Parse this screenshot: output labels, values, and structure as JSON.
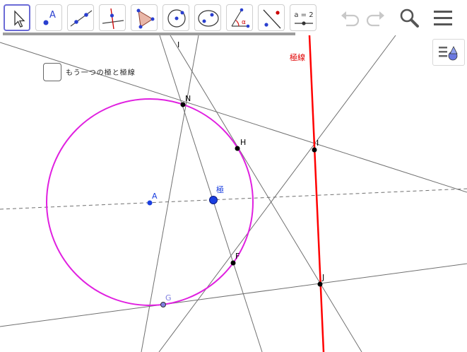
{
  "toolbar": {
    "tools": [
      {
        "name": "move-tool-icon"
      },
      {
        "name": "point-tool-icon",
        "label": "A"
      },
      {
        "name": "line-tool-icon"
      },
      {
        "name": "perpendicular-line-tool-icon"
      },
      {
        "name": "polygon-tool-icon"
      },
      {
        "name": "circle-tool-icon"
      },
      {
        "name": "conic-tool-icon"
      },
      {
        "name": "angle-tool-icon",
        "label": "α"
      },
      {
        "name": "reflect-tool-icon"
      },
      {
        "name": "slider-tool-icon",
        "label": "a = 2"
      }
    ],
    "undo_icon": "undo-icon",
    "redo_icon": "redo-icon",
    "search_icon": "search-icon",
    "menu_icon": "menu-icon"
  },
  "checkbox": {
    "label": "もう一つの極と極線",
    "checked": false
  },
  "graphics": {
    "colors": {
      "circle": "#e020e0",
      "polar_line": "#ff0000",
      "point_fill": "#000000",
      "center_point": "#1a3fe0",
      "pole_point": "#1a3fe0",
      "line": "#707070",
      "free_point_G": "#8080e0"
    },
    "labels": {
      "line_I": "I",
      "polar_line": "極線",
      "N": "N",
      "H": "H",
      "I": "I",
      "A": "A",
      "pole": "極",
      "F": "F",
      "J": "J",
      "G": "G"
    }
  }
}
